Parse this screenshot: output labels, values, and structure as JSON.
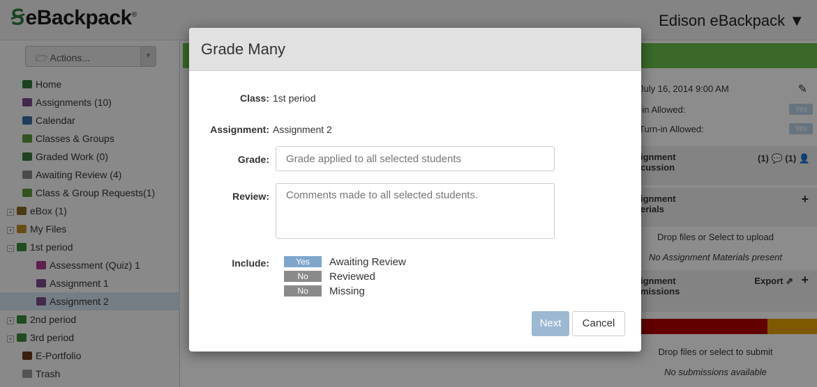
{
  "header": {
    "logo_text": "eBackpack",
    "logo_mark": "registered",
    "org_title": "Edison eBackpack ▼"
  },
  "sidebar": {
    "actions_label": "Actions...",
    "items": [
      {
        "label": "Home",
        "icon": "home-icon",
        "color": "#2e7a3b"
      },
      {
        "label": "Assignments (10)",
        "icon": "backpack-icon",
        "color": "#7a4c8a"
      },
      {
        "label": "Calendar",
        "icon": "calendar-icon",
        "color": "#3a6ea5"
      },
      {
        "label": "Classes & Groups",
        "icon": "group-icon",
        "color": "#5c9a3a"
      },
      {
        "label": "Graded Work (0)",
        "icon": "graded-icon",
        "color": "#3b7a3b"
      },
      {
        "label": "Awaiting Review (4)",
        "icon": "pencil-icon",
        "color": "#888888"
      },
      {
        "label": "Class & Group Requests(1)",
        "icon": "requests-icon",
        "color": "#5c9a3a"
      },
      {
        "label": "eBox (1)",
        "icon": "ebox-icon",
        "color": "#8a6a2a"
      },
      {
        "label": "My Files",
        "icon": "folder-icon",
        "color": "#c28a2c"
      },
      {
        "label": "1st period",
        "icon": "folder-icon",
        "color": "#3b8a3b"
      },
      {
        "label": "Assessment (Quiz) 1",
        "icon": "quiz-icon",
        "color": "#b03a8a"
      },
      {
        "label": "Assignment 1",
        "icon": "backpack-icon",
        "color": "#7a4c8a"
      },
      {
        "label": "Assignment 2",
        "icon": "backpack-icon",
        "color": "#7a4c8a"
      },
      {
        "label": "2nd period",
        "icon": "folder-icon",
        "color": "#3b8a3b"
      },
      {
        "label": "3rd period",
        "icon": "folder-icon",
        "color": "#3b8a3b"
      },
      {
        "label": "E-Portfolio",
        "icon": "portfolio-icon",
        "color": "#6a3a1a"
      },
      {
        "label": "Trash",
        "icon": "trash-icon",
        "color": "#999999"
      }
    ]
  },
  "right_panel": {
    "due_date": "July 16, 2014 9:00 AM",
    "row1_label": "-in Allowed:",
    "row1_value": "Yes",
    "row2_label": "Turn-in Allowed:",
    "row2_value": "Yes",
    "discussion_head": "ignment\ncussion",
    "discussion_counts": "(1) 💬 (1) 👤",
    "materials_head": "ignment\nerials",
    "materials_drop": "Drop files or Select to upload",
    "materials_none": "No Assignment Materials present",
    "submissions_head": "ignment\nmissions",
    "export_label": "Export",
    "submit_drop": "Drop files or select to submit",
    "submissions_none": "No submissions available"
  },
  "modal": {
    "title": "Grade Many",
    "class_label": "Class:",
    "class_value": "1st period",
    "assignment_label": "Assignment:",
    "assignment_value": "Assignment 2",
    "grade_label": "Grade:",
    "grade_placeholder": "Grade applied to all selected students",
    "review_label": "Review:",
    "review_placeholder": "Comments made to all selected students.",
    "include_label": "Include:",
    "include_options": [
      {
        "toggle": "Yes",
        "label": "Awaiting Review"
      },
      {
        "toggle": "No",
        "label": "Reviewed"
      },
      {
        "toggle": "No",
        "label": "Missing"
      }
    ],
    "next_label": "Next",
    "cancel_label": "Cancel"
  },
  "colors": {
    "brand_green": "#6abf4b",
    "toggle_yes": "#7fa7cc",
    "toggle_no": "#8a8a8a",
    "next_button": "#9db8d1"
  }
}
